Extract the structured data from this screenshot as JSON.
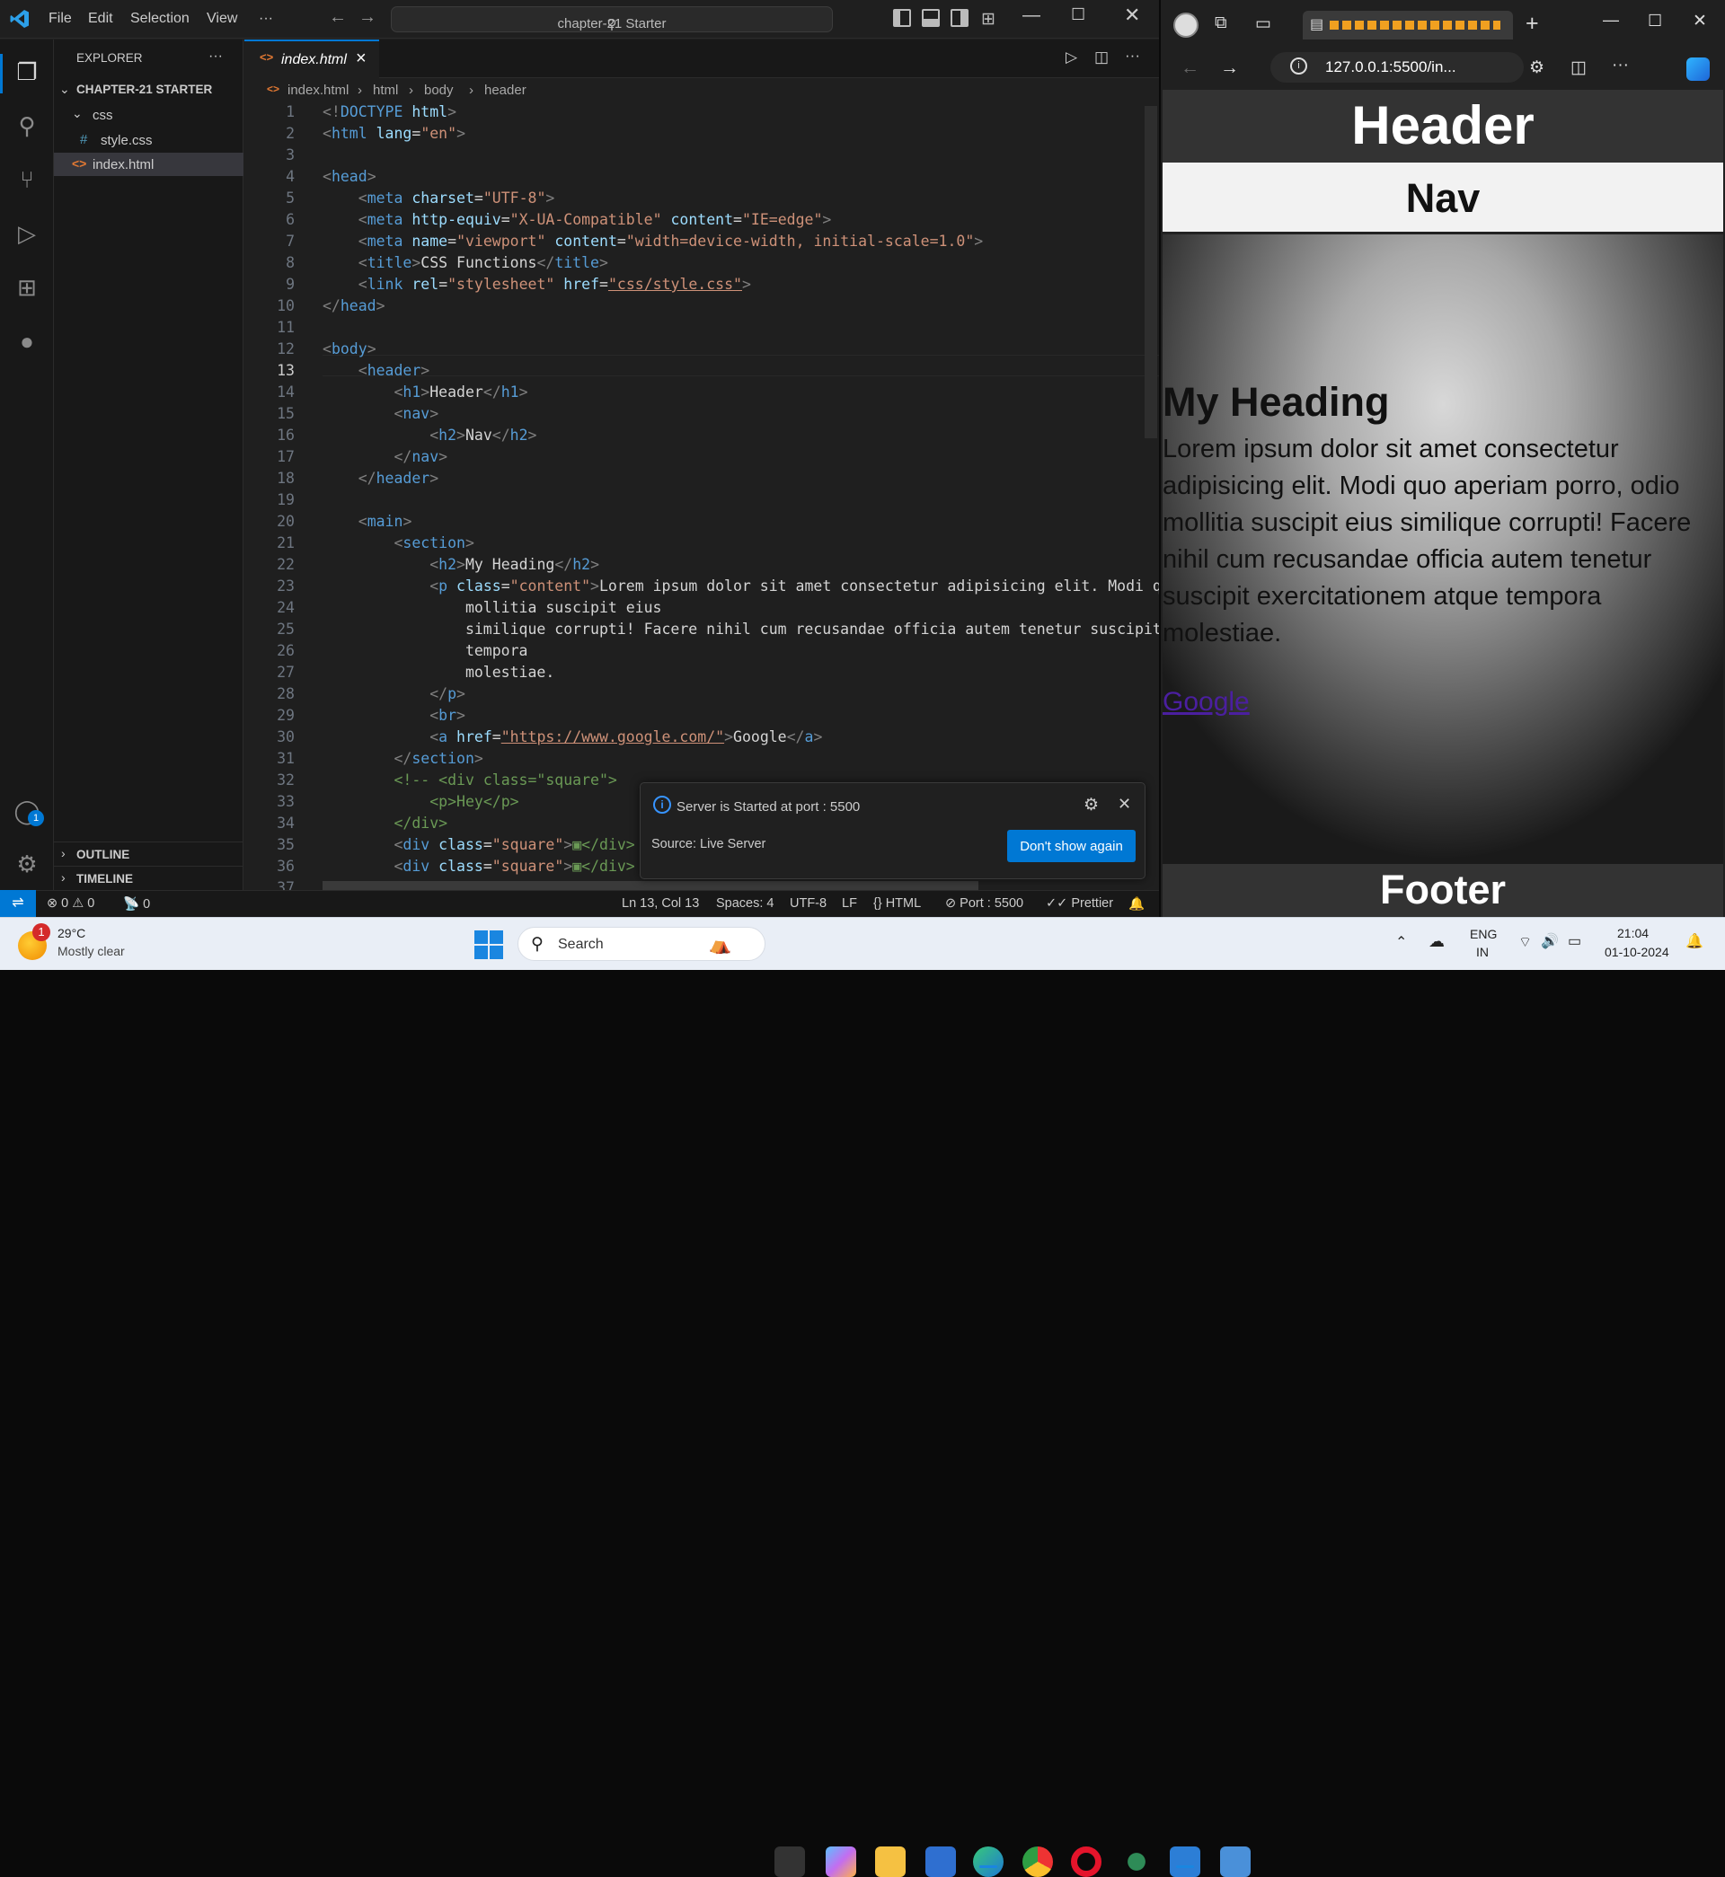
{
  "vscode": {
    "menu": [
      "File",
      "Edit",
      "Selection",
      "View",
      "···"
    ],
    "search_text": "chapter-21 Starter",
    "explorer": {
      "title": "EXPLORER",
      "more": "···",
      "root": "CHAPTER-21 STARTER",
      "folder": "css",
      "file_css": "style.css",
      "file_html": "index.html",
      "outline": "OUTLINE",
      "timeline": "TIMELINE"
    },
    "account_badge": "1",
    "tab": {
      "label": "index.html",
      "close": "×"
    },
    "breadcrumb": [
      "index.html",
      "html",
      "body",
      "header"
    ],
    "code_lines": [
      "1",
      "2",
      "3",
      "4",
      "5",
      "6",
      "7",
      "8",
      "9",
      "10",
      "11",
      "12",
      "13",
      "14",
      "15",
      "16",
      "17",
      "18",
      "19",
      "20",
      "21",
      "22",
      "23",
      "24",
      "25",
      "26",
      "27",
      "28",
      "29",
      "30",
      "31",
      "32",
      "33",
      "34",
      "35",
      "36",
      "37"
    ],
    "status": {
      "remote": "⇌",
      "problems": "⊗ 0 ⚠ 0",
      "ports": "📡 0",
      "position": "Ln 13, Col 13",
      "spaces": "Spaces: 4",
      "encoding": "UTF-8",
      "eol": "LF",
      "language": "{} HTML",
      "port": "⊘ Port : 5500",
      "prettier": "✓✓ Prettier"
    },
    "notification": {
      "message": "Server is Started at port : 5500",
      "source": "Source: Live Server",
      "button": "Don't show again"
    }
  },
  "browser": {
    "url": "127.0.0.1:5500/in...",
    "page": {
      "header": "Header",
      "nav": "Nav",
      "heading": "My Heading",
      "paragraph": "Lorem ipsum dolor sit amet consectetur adipisicing elit. Modi quo aperiam porro, odio mollitia suscipit eius similique corrupti! Facere nihil cum recusandae officia autem tenetur suscipit exercitationem atque tempora molestiae.",
      "link": "Google",
      "footer": "Footer"
    }
  },
  "taskbar": {
    "weather_temp": "29°C",
    "weather_desc": "Mostly clear",
    "weather_badge": "1",
    "search": "Search",
    "lang_top": "ENG",
    "lang_bottom": "IN",
    "time": "21:04",
    "date": "01-10-2024"
  },
  "colors": {
    "accent": "#0078d4",
    "editor_bg": "#1f1f1f",
    "sidebar_bg": "#181818",
    "tag": "#569cd6",
    "attr": "#9cdcfe",
    "string": "#ce9178"
  }
}
